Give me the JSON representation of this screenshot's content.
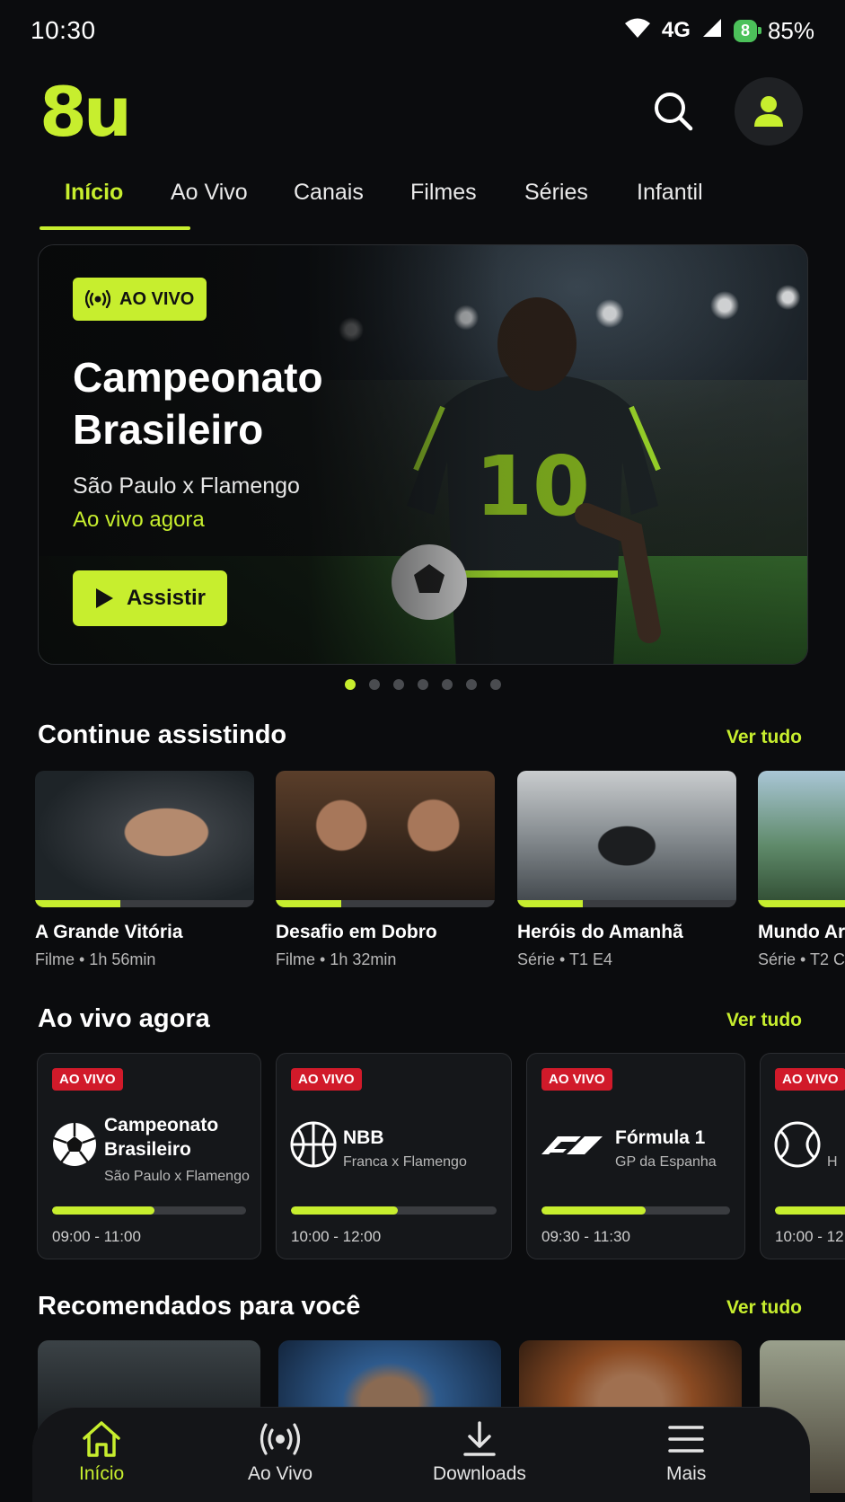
{
  "status_bar": {
    "time": "10:30",
    "network": "4G",
    "battery_pill": "8",
    "battery_percent": "85%"
  },
  "header": {
    "logo": "8u"
  },
  "tabs": [
    {
      "label": "Início",
      "active": true
    },
    {
      "label": "Ao Vivo",
      "active": false
    },
    {
      "label": "Canais",
      "active": false
    },
    {
      "label": "Filmes",
      "active": false
    },
    {
      "label": "Séries",
      "active": false
    },
    {
      "label": "Infantil",
      "active": false
    }
  ],
  "hero": {
    "badge": "AO VIVO",
    "title": "Campeonato Brasileiro",
    "subtitle": "São Paulo x Flamengo",
    "status": "Ao vivo agora",
    "button": "Assistir",
    "jersey_number": "10",
    "carousel_count": 7,
    "carousel_active": 0
  },
  "continue_watching": {
    "title": "Continue assistindo",
    "link": "Ver tudo",
    "items": [
      {
        "title": "A Grande Vitória",
        "meta": "Filme • 1h 56min",
        "progress": 0.39
      },
      {
        "title": "Desafio em Dobro",
        "meta": "Filme • 1h 32min",
        "progress": 0.3
      },
      {
        "title": "Heróis do Amanhã",
        "meta": "Série • T1 E4",
        "progress": 0.3
      },
      {
        "title": "Mundo Ar",
        "meta": "Série • T2 C",
        "progress": 0.65
      }
    ]
  },
  "live_now": {
    "title": "Ao vivo agora",
    "link": "Ver tudo",
    "badge": "AO VIVO",
    "items": [
      {
        "name_line1": "Campeonato",
        "name_line2": "Brasileiro",
        "desc": "São Paulo x Flamengo",
        "time": "09:00 - 11:00",
        "progress": 0.53,
        "icon": "soccer-ball-icon"
      },
      {
        "name_line1": "NBB",
        "name_line2": "",
        "desc": "Franca x Flamengo",
        "time": "10:00 - 12:00",
        "progress": 0.52,
        "icon": "basketball-icon"
      },
      {
        "name_line1": "Fórmula 1",
        "name_line2": "",
        "desc": "GP da Espanha",
        "time": "09:30 - 11:30",
        "progress": 0.55,
        "icon": "f1-logo-icon"
      },
      {
        "name_line1": "",
        "name_line2": "",
        "desc": "H",
        "time": "10:00 - 12",
        "progress": 0.8,
        "icon": "tennis-ball-icon"
      }
    ]
  },
  "recommended": {
    "title": "Recomendados para você",
    "link": "Ver tudo"
  },
  "bottom_nav": [
    {
      "label": "Início",
      "icon": "home-icon",
      "active": true
    },
    {
      "label": "Ao Vivo",
      "icon": "broadcast-icon",
      "active": false
    },
    {
      "label": "Downloads",
      "icon": "download-icon",
      "active": false
    },
    {
      "label": "Mais",
      "icon": "menu-icon",
      "active": false
    }
  ],
  "colors": {
    "accent": "#c7ee2e",
    "background": "#0b0c0e",
    "live_red": "#d11a2a"
  }
}
